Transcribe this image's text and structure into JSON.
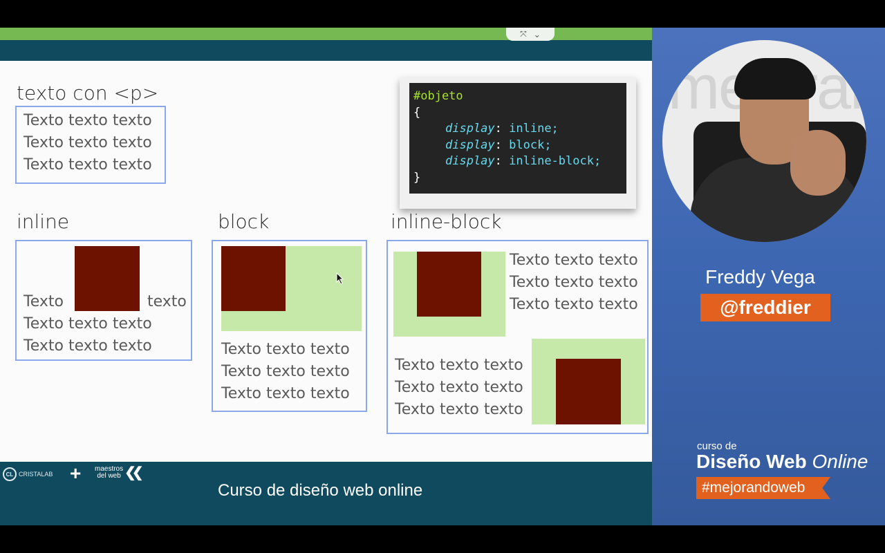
{
  "slide": {
    "heading_p": "texto con <p>",
    "heading_inline": "inline",
    "heading_block": "block",
    "heading_inline_block": "inline-block",
    "para_line": "Texto texto texto",
    "inline_left": "Texto",
    "inline_right": "texto",
    "controls": {
      "expand_icon": "⤧",
      "chevron_icon": "⌄"
    }
  },
  "code": {
    "selector": "#objeto",
    "open_brace": "{",
    "close_brace": "}",
    "lines": [
      {
        "prop": "display",
        "value": "inline;"
      },
      {
        "prop": "display",
        "value": "block;"
      },
      {
        "prop": "display",
        "value": "inline-block;"
      }
    ]
  },
  "footer": {
    "caption": "Curso de diseño web online",
    "logo_cl_mark": "CL",
    "logo_cl_text": "CRISTALAB",
    "plus": "+",
    "logo_mdw_line1": "maestros",
    "logo_mdw_line2": "del web",
    "logo_mdw_chevrons": "❮❮"
  },
  "panel": {
    "wall_text": "mejoran",
    "presenter_name": "Freddy Vega",
    "presenter_handle": "@freddier",
    "course_prefix": "curso de",
    "course_title_bold": "Diseño Web",
    "course_title_italic": "Online",
    "hashtag": "#mejorandoweb"
  },
  "colors": {
    "accent_orange": "#e3611e",
    "slide_green": "#76b852",
    "teal": "#0f4a5e",
    "panel_blue": "#4c72bd",
    "box_red": "#6e1200",
    "box_green": "#c6e8a9"
  }
}
